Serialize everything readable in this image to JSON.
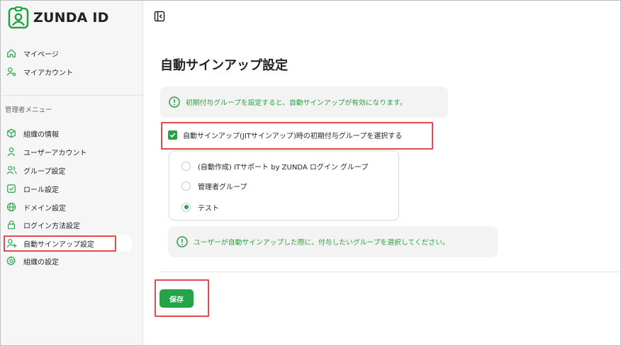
{
  "app": {
    "name": "ZUNDA ID"
  },
  "sidebar": {
    "user_items": [
      {
        "label": "マイページ",
        "icon": "home-icon"
      },
      {
        "label": "マイアカウント",
        "icon": "user-settings-icon"
      }
    ],
    "admin_section_label": "管理者メニュー",
    "admin_items": [
      {
        "label": "組織の情報",
        "icon": "cube-icon"
      },
      {
        "label": "ユーザーアカウント",
        "icon": "user-icon"
      },
      {
        "label": "グループ設定",
        "icon": "users-icon"
      },
      {
        "label": "ロール設定",
        "icon": "checkbox-icon"
      },
      {
        "label": "ドメイン設定",
        "icon": "globe-icon"
      },
      {
        "label": "ログイン方法設定",
        "icon": "lock-icon"
      },
      {
        "label": "自動サインアップ設定",
        "icon": "user-plus-icon",
        "active": true
      },
      {
        "label": "組織の設定",
        "icon": "gear-icon"
      }
    ]
  },
  "main": {
    "title": "自動サインアップ設定",
    "info_top": "初期付与グループを設定すると、自動サインアップが有効になります。",
    "checkbox_label": "自動サインアップ(JITサインアップ)時の初期付与グループを選択する",
    "checkbox_checked": true,
    "groups": [
      {
        "label": "(自動作成) ITサポート by ZUNDA ログイン グループ",
        "selected": false
      },
      {
        "label": "管理者グループ",
        "selected": false
      },
      {
        "label": "テスト",
        "selected": true
      }
    ],
    "info_bottom": "ユーザーが自動サインアップした際に、付与したいグループを選択してください。",
    "save_label": "保存"
  },
  "colors": {
    "accent": "#22a447",
    "info_text": "#2f9e44",
    "highlight": "#e5484d"
  }
}
